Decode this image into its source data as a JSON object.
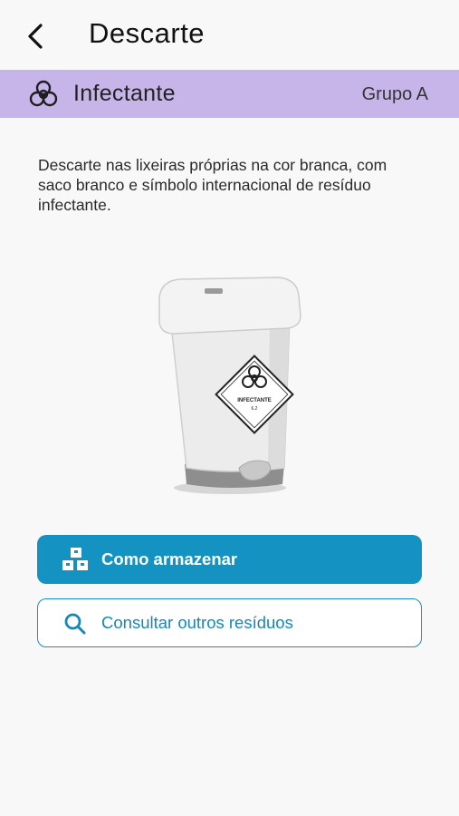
{
  "header": {
    "title": "Descarte",
    "back_icon": "chevron-left-icon"
  },
  "category": {
    "name": "Infectante",
    "group": "Grupo A",
    "icon": "biohazard-icon",
    "color": "#c7b5e9"
  },
  "description": "Descarte nas lixeiras próprias na cor branca, com saco branco e símbolo internacional de resíduo infectante.",
  "bin_image": {
    "label": "INFECTANTE"
  },
  "actions": {
    "store": {
      "label": "Como armazenar",
      "icon": "boxes-icon",
      "color": "#1493c2"
    },
    "search": {
      "label": "Consultar outros resíduos",
      "icon": "search-icon",
      "color": "#1488b8"
    }
  }
}
